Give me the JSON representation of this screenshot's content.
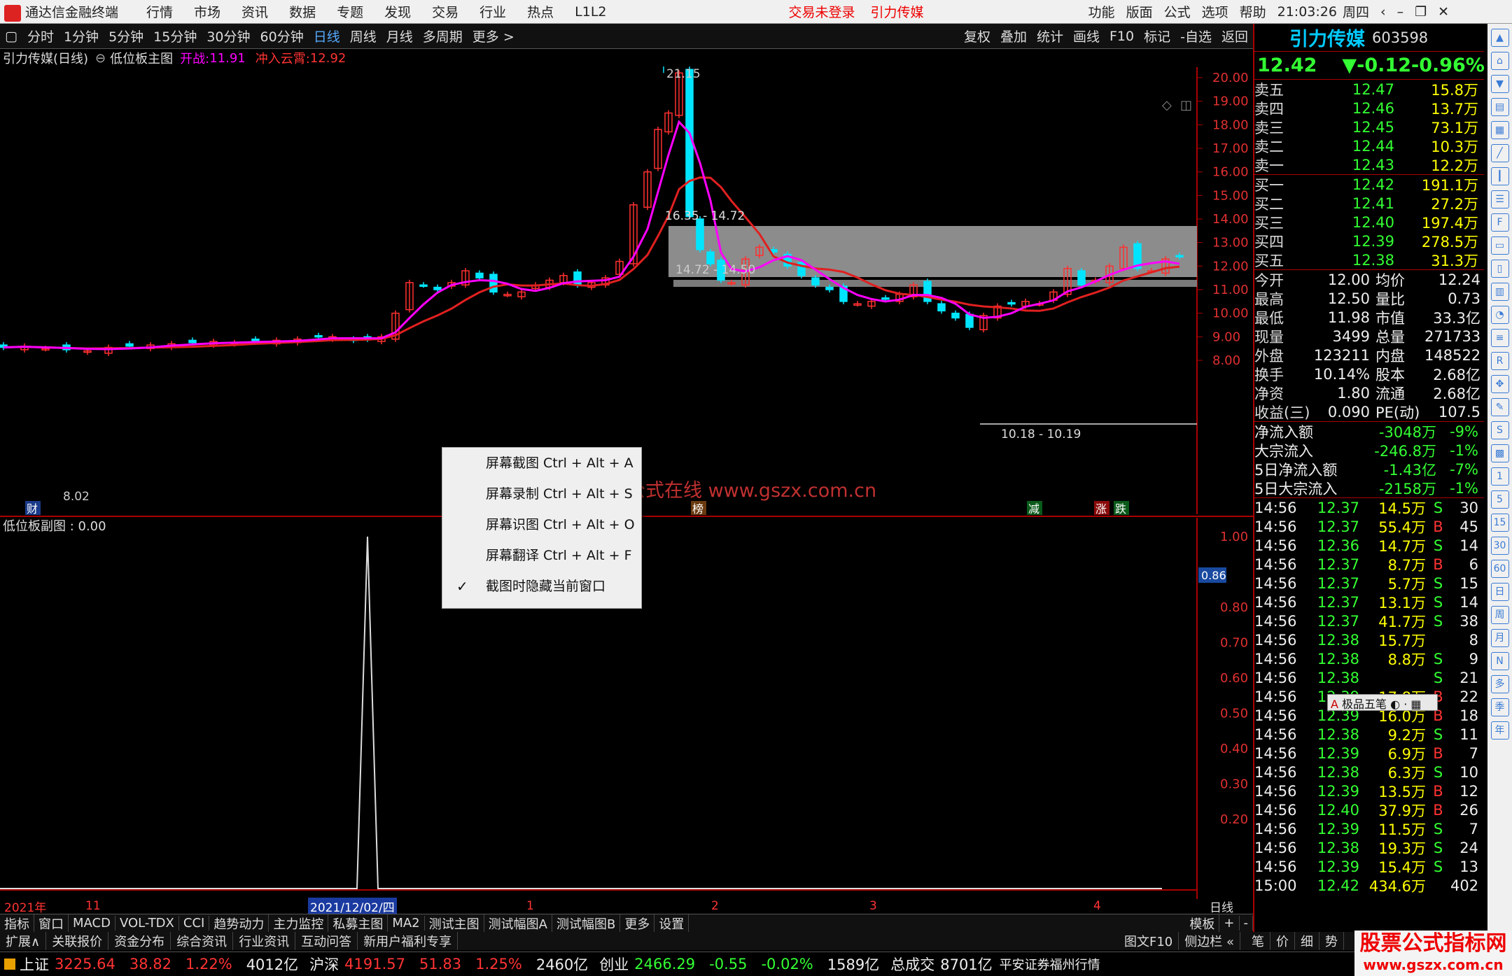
{
  "titlebar": {
    "app": "通达信金融终端",
    "menus": [
      "行情",
      "市场",
      "资讯",
      "数据",
      "专题",
      "发现",
      "交易",
      "行业",
      "热点",
      "L1L2"
    ],
    "login": "交易未登录",
    "stock": "引力传媒",
    "right": [
      "功能",
      "版面",
      "公式",
      "选项",
      "帮助"
    ],
    "time": "21:03:26",
    "weekday": "周四"
  },
  "periods": [
    "分时",
    "1分钟",
    "5分钟",
    "15分钟",
    "30分钟",
    "60分钟",
    "日线",
    "周线",
    "月线",
    "多周期",
    "更多 >"
  ],
  "toolbar_right": [
    "复权",
    "叠加",
    "统计",
    "画线",
    "F10",
    "标记",
    "-自选",
    "返回"
  ],
  "chart": {
    "title": "引力传媒(日线)",
    "indicator": "低位板主图",
    "open_war_label": "开战:",
    "open_war": "11.91",
    "cloud_label": "冲入云霄:",
    "cloud": "12.92",
    "price_ticks": [
      "20.00",
      "19.00",
      "18.00",
      "17.00",
      "16.00",
      "15.00",
      "14.00",
      "13.00",
      "12.00",
      "11.00",
      "10.00",
      "9.00",
      "8.00"
    ],
    "high_label": "21.15",
    "low_label": "8.02",
    "zone1": "16.35 - 14.72",
    "zone2": "14.72 - 14.50",
    "zone3": "10.18 - 10.19",
    "markers": {
      "cai": "财",
      "bang": "榜",
      "jian": "减",
      "zhang": "涨",
      "die": "跌"
    }
  },
  "sub": {
    "title": "低位板副图 : 0.00",
    "ticks": [
      "1.00",
      "0.80",
      "0.70",
      "0.60",
      "0.50",
      "0.40",
      "0.30",
      "0.20"
    ],
    "cursor_value": "0.86"
  },
  "chart_data": {
    "type": "candlestick",
    "title": "引力传媒(日线)",
    "xlabel_ticks": [
      "2021年",
      "11",
      "2021/12/02/四",
      "1",
      "2",
      "3",
      "4"
    ],
    "ylim": [
      7.5,
      21.5
    ],
    "ma_series": [
      "MA-red",
      "MA-magenta"
    ],
    "sub_spike_value": 1.0
  },
  "xaxis": {
    "labels": [
      "2021年",
      "11",
      "2021/12/02/四",
      "1",
      "2",
      "3",
      "4"
    ],
    "right_label": "日线"
  },
  "menu": {
    "items": [
      "屏幕截图 Ctrl + Alt + A",
      "屏幕录制 Ctrl + Alt + S",
      "屏幕识图 Ctrl + Alt + O",
      "屏幕翻译 Ctrl + Alt + F",
      "截图时隐藏当前窗口"
    ],
    "check": "✓"
  },
  "watermark_text": "公式在线  www.gszx.com.cn",
  "quote": {
    "name": "引力传媒",
    "code": "603598",
    "price": "12.42",
    "change": "▼-0.12",
    "pct": "-0.96%",
    "asks": [
      [
        "卖五",
        "12.47",
        "15.8万"
      ],
      [
        "卖四",
        "12.46",
        "13.7万"
      ],
      [
        "卖三",
        "12.45",
        "73.1万"
      ],
      [
        "卖二",
        "12.44",
        "10.3万"
      ],
      [
        "卖一",
        "12.43",
        "12.2万"
      ]
    ],
    "bids": [
      [
        "买一",
        "12.42",
        "191.1万"
      ],
      [
        "买二",
        "12.41",
        "27.2万"
      ],
      [
        "买三",
        "12.40",
        "197.4万"
      ],
      [
        "买四",
        "12.39",
        "278.5万"
      ],
      [
        "买五",
        "12.38",
        "31.3万"
      ]
    ],
    "stats": [
      [
        "今开",
        "12.00",
        "均价",
        "12.24"
      ],
      [
        "最高",
        "12.50",
        "量比",
        "0.73"
      ],
      [
        "最低",
        "11.98",
        "市值",
        "33.3亿"
      ],
      [
        "现量",
        "3499",
        "总量",
        "271733"
      ],
      [
        "外盘",
        "123211",
        "内盘",
        "148522"
      ],
      [
        "换手",
        "10.14%",
        "股本",
        "2.68亿"
      ],
      [
        "净资",
        "1.80",
        "流通",
        "2.68亿"
      ],
      [
        "收益(三)",
        "0.090",
        "PE(动)",
        "107.5"
      ]
    ],
    "flows": [
      [
        "净流入额",
        "-3048万",
        "-9%"
      ],
      [
        "大宗流入",
        "-246.8万",
        "-1%"
      ],
      [
        "5日净流入额",
        "-1.43亿",
        "-7%"
      ],
      [
        "5日大宗流入",
        "-2158万",
        "-1%"
      ]
    ],
    "ticks": [
      [
        "14:56",
        "12.37",
        "14.5万",
        "S",
        "30"
      ],
      [
        "14:56",
        "12.37",
        "55.4万",
        "B",
        "45"
      ],
      [
        "14:56",
        "12.36",
        "14.7万",
        "S",
        "14"
      ],
      [
        "14:56",
        "12.37",
        "8.7万",
        "B",
        "6"
      ],
      [
        "14:56",
        "12.37",
        "5.7万",
        "S",
        "15"
      ],
      [
        "14:56",
        "12.37",
        "13.1万",
        "S",
        "14"
      ],
      [
        "14:56",
        "12.37",
        "41.7万",
        "S",
        "38"
      ],
      [
        "14:56",
        "12.38",
        "15.7万",
        "",
        "8"
      ],
      [
        "14:56",
        "12.38",
        "8.8万",
        "S",
        "9"
      ],
      [
        "14:56",
        "12.38",
        "",
        "S",
        "21"
      ],
      [
        "14:56",
        "12.39",
        "17.8万",
        "B",
        "22"
      ],
      [
        "14:56",
        "12.39",
        "16.0万",
        "B",
        "18"
      ],
      [
        "14:56",
        "12.38",
        "9.2万",
        "S",
        "11"
      ],
      [
        "14:56",
        "12.39",
        "6.9万",
        "B",
        "7"
      ],
      [
        "14:56",
        "12.38",
        "6.3万",
        "S",
        "10"
      ],
      [
        "14:56",
        "12.39",
        "13.5万",
        "B",
        "12"
      ],
      [
        "14:56",
        "12.40",
        "37.9万",
        "B",
        "26"
      ],
      [
        "14:56",
        "12.39",
        "11.5万",
        "S",
        "7"
      ],
      [
        "14:56",
        "12.38",
        "19.3万",
        "S",
        "24"
      ],
      [
        "14:56",
        "12.39",
        "15.4万",
        "S",
        "13"
      ],
      [
        "15:00",
        "12.42",
        "434.6万",
        "",
        "402"
      ]
    ],
    "ime": "极品五笔"
  },
  "bottomtabs": [
    "指标",
    "窗口",
    "MACD",
    "VOL-TDX",
    "CCI",
    "趋势动力",
    "主力监控",
    "私募主图",
    "MA2",
    "测试主图",
    "测试幅图A",
    "测试幅图B",
    "更多",
    "设置"
  ],
  "bottomtabs_right": [
    "模板",
    "+",
    "-"
  ],
  "bottomtabs2": [
    "扩展∧",
    "关联报价",
    "资金分布",
    "综合资讯",
    "行业资讯",
    "互动问答",
    "新用户福利专享"
  ],
  "bottomtabs2_right": [
    "图文F10",
    "侧边栏 «",
    "笔",
    "价",
    "细",
    "势"
  ],
  "status": {
    "sh": "上证",
    "sh_val": "3225.64",
    "sh_chg": "38.82",
    "sh_pct": "1.22%",
    "sh_amt": "4012亿",
    "sz": "沪深",
    "sz_val": "4191.57",
    "sz_chg": "51.83",
    "sz_pct": "1.25%",
    "sz_amt": "2460亿",
    "cy": "创业",
    "cy_val": "2466.29",
    "cy_chg": "-0.55",
    "cy_pct": "-0.02%",
    "cy_amt": "1589亿",
    "total": "总成交",
    "total_amt": "8701亿",
    "broker": "平安证券福州行情"
  },
  "wm": {
    "line1": "股票公式指标网",
    "line2": "www.gszx.com.cn"
  },
  "sidebar_icons": [
    "1",
    "5",
    "15",
    "30",
    "60",
    "日",
    "周",
    "月",
    "N",
    "多",
    "季",
    "年"
  ]
}
